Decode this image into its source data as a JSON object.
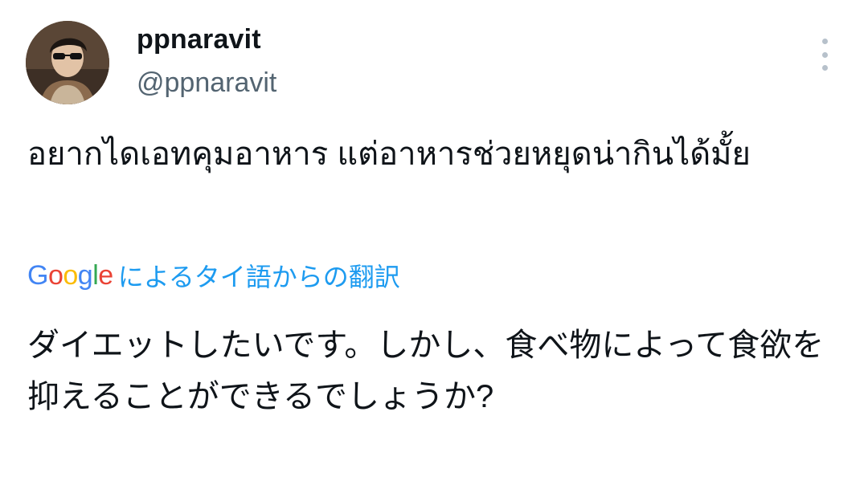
{
  "user": {
    "display_name": "ppnaravit",
    "handle": "@ppnaravit"
  },
  "tweet": {
    "text": "อยากไดเอทคุมอาหาร แต่อาหารช่วยหยุดน่ากินได้มั้ย"
  },
  "translation": {
    "provider_label": "によるタイ語からの翻訳",
    "text": "ダイエットしたいです。しかし、食べ物によって食欲を抑えることができるでしょうか?"
  },
  "icons": {
    "more": "more-vertical-icon",
    "google": "google-logo"
  },
  "colors": {
    "link": "#1d9bf0",
    "secondary_text": "#536471",
    "primary_text": "#0f1419",
    "more_dots": "#b7c1cb"
  }
}
